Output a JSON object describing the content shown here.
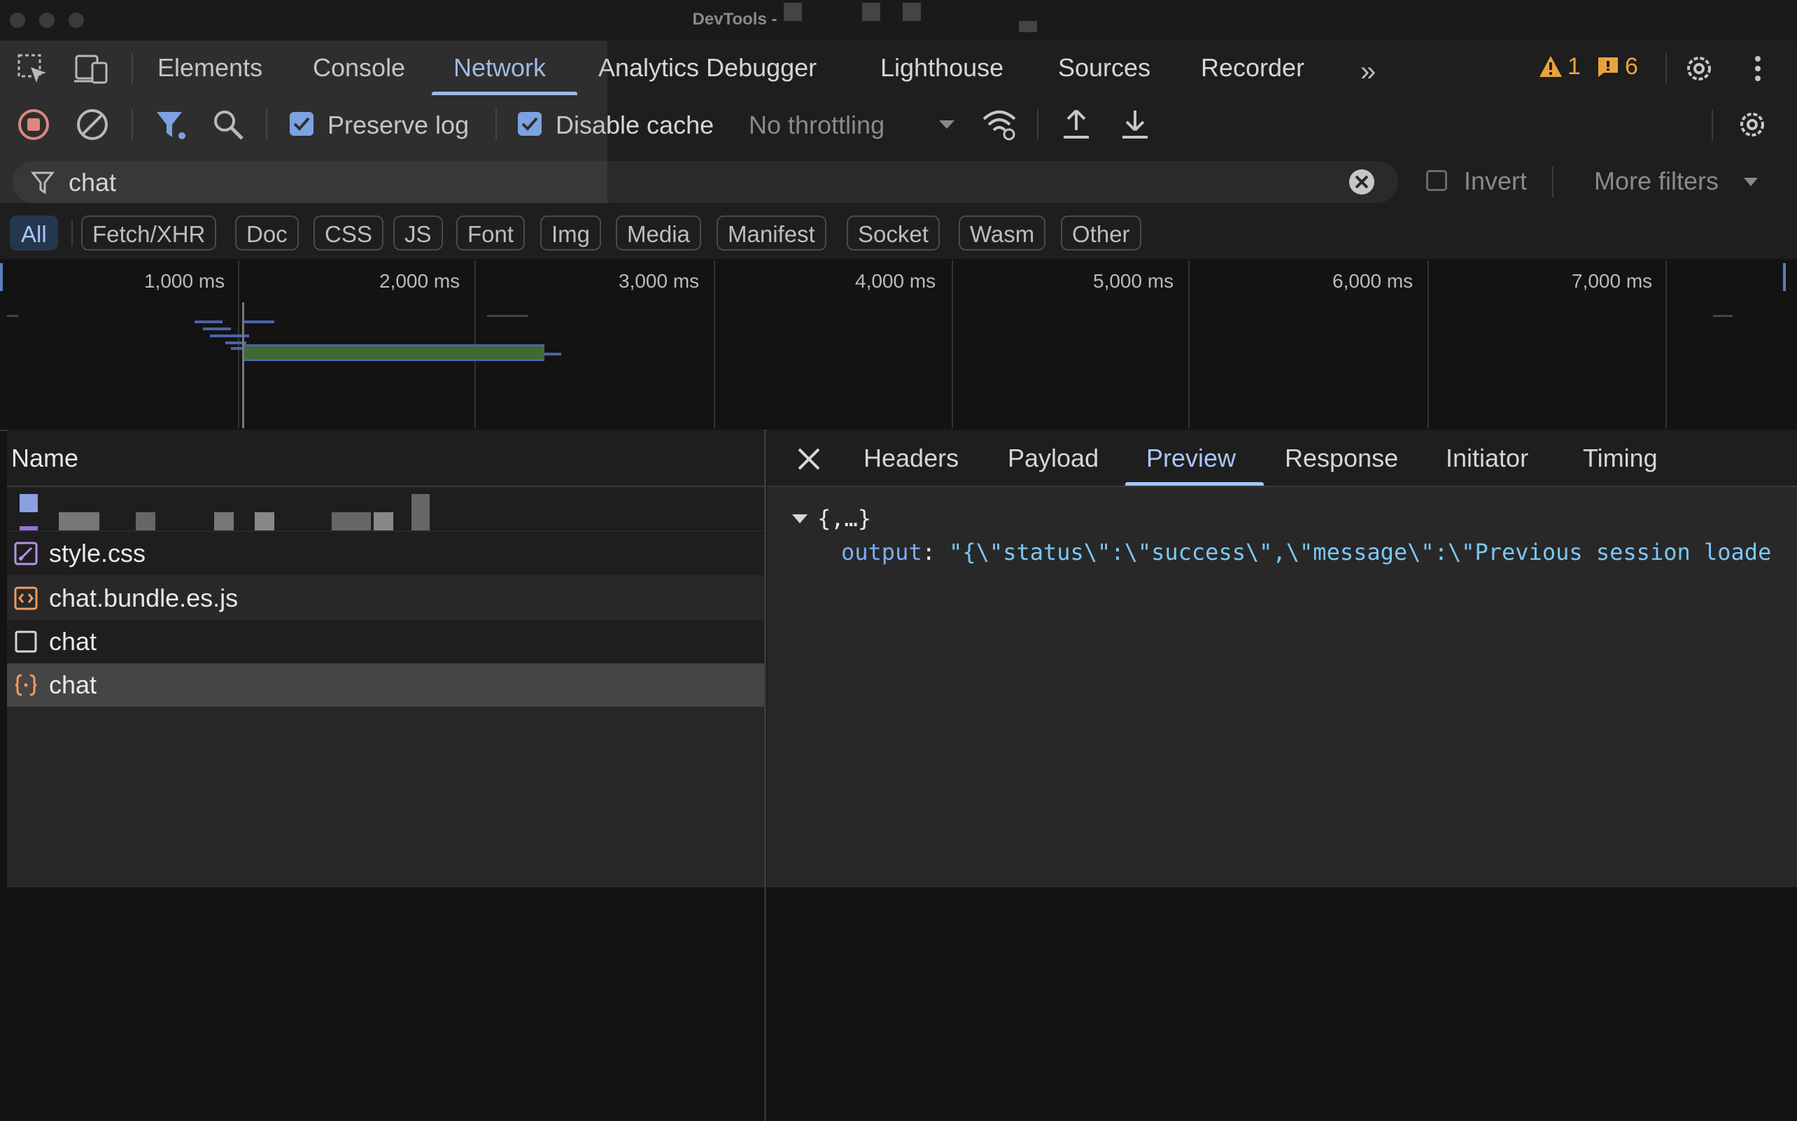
{
  "window": {
    "title": "DevTools -"
  },
  "tabs": [
    {
      "label": "Elements"
    },
    {
      "label": "Console"
    },
    {
      "label": "Network"
    },
    {
      "label": "Analytics Debugger"
    },
    {
      "label": "Lighthouse"
    },
    {
      "label": "Sources"
    },
    {
      "label": "Recorder"
    }
  ],
  "status": {
    "warnings": "1",
    "issues": "6"
  },
  "toolbar": {
    "preserve_log": "Preserve log",
    "disable_cache": "Disable cache",
    "throttling": "No throttling"
  },
  "filter": {
    "value": "chat",
    "invert": "Invert",
    "more_filters": "More filters"
  },
  "type_filters": [
    "All",
    "Fetch/XHR",
    "Doc",
    "CSS",
    "JS",
    "Font",
    "Img",
    "Media",
    "Manifest",
    "Socket",
    "Wasm",
    "Other"
  ],
  "timeline": {
    "ticks": [
      "1,000 ms",
      "2,000 ms",
      "3,000 ms",
      "4,000 ms",
      "5,000 ms",
      "6,000 ms",
      "7,000 ms"
    ]
  },
  "requests": {
    "header": "Name",
    "rows": [
      {
        "name": "style.css",
        "icon": "css-file-icon"
      },
      {
        "name": "chat.bundle.es.js",
        "icon": "js-file-icon"
      },
      {
        "name": "chat",
        "icon": "document-icon"
      },
      {
        "name": "chat",
        "icon": "fetch-json-icon"
      }
    ]
  },
  "details": {
    "tabs": [
      "Headers",
      "Payload",
      "Preview",
      "Response",
      "Initiator",
      "Timing"
    ],
    "active_tab": "Preview",
    "preview_root": "{,…}",
    "preview_key": "output",
    "preview_value": "\"{\\\"status\\\":\\\"success\\\",\\\"message\\\":\\\"Previous session loade"
  },
  "colors": {
    "accent": "#a8c7fa",
    "record": "#f28b82",
    "warning": "#e8a33d",
    "css_icon": "#b494e8",
    "js_icon": "#f29a5e"
  }
}
